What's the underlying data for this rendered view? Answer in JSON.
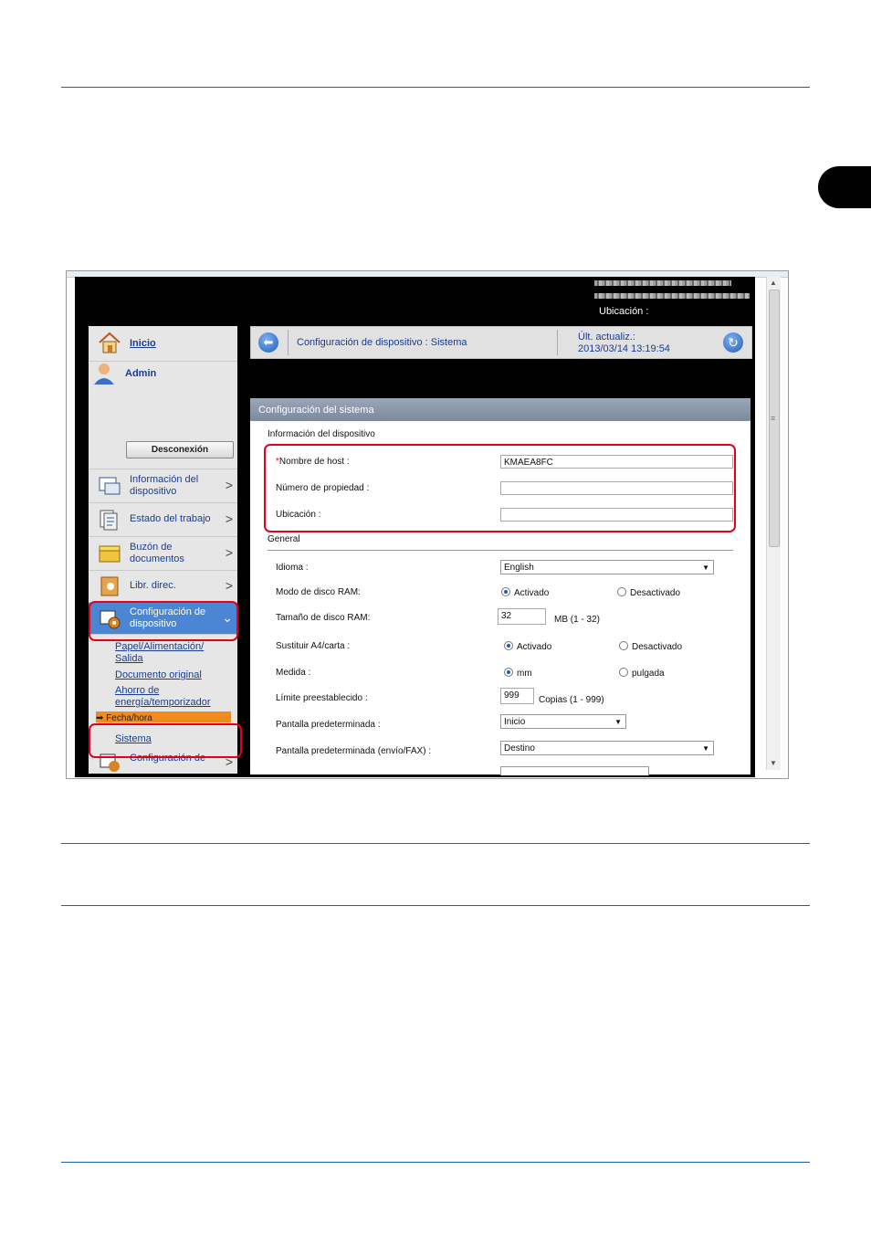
{
  "header_bar": {
    "ubicacion_label": "Ubicación :"
  },
  "sidebar": {
    "inicio": "Inicio",
    "admin": "Admin",
    "logout_button": "Desconexión",
    "items": [
      {
        "label": "Información del dispositivo"
      },
      {
        "label": "Estado del trabajo"
      },
      {
        "label": "Buzón de documentos"
      },
      {
        "label": "Libr. direc."
      },
      {
        "label": "Configuración de dispositivo"
      }
    ],
    "subitems": [
      "Papel/Alimentación/ Salida",
      "Documento original",
      "Ahorro de energía/temporizador",
      "Fecha/hora",
      "Sistema"
    ],
    "next_item": "Configuración de"
  },
  "titlebar": {
    "title": "Configuración de dispositivo : Sistema",
    "updated_label": "Últ. actualiz.:",
    "updated_value": "2013/03/14 13:19:54"
  },
  "panel": {
    "header": "Configuración del sistema",
    "section_device": "Información del dispositivo",
    "host_label": "Nombre de host :",
    "host_value": "KMAEA8FC",
    "asset_label": "Número de propiedad :",
    "asset_value": "",
    "location_label": "Ubicación :",
    "location_value": "",
    "section_general": "General",
    "language_label": "Idioma :",
    "language_value": "English",
    "ramdisk_mode_label": "Modo de disco RAM:",
    "ramdisk_size_label": "Tamaño de disco RAM:",
    "ramdisk_size_value": "32",
    "ramdisk_size_unit": "MB (1 - 32)",
    "a4_label": "Sustituir A4/carta :",
    "measure_label": "Medida :",
    "limit_label": "Límite preestablecido :",
    "limit_value": "999",
    "limit_unit": "Copias (1 - 999)",
    "default_screen_label": "Pantalla predeterminada :",
    "default_screen_value": "Inicio",
    "default_screen_fax_label": "Pantalla predeterminada (envío/FAX) :",
    "default_screen_fax_value": "Destino",
    "opt_on": "Activado",
    "opt_off": "Desactivado",
    "opt_mm": "mm",
    "opt_inch": "pulgada"
  }
}
